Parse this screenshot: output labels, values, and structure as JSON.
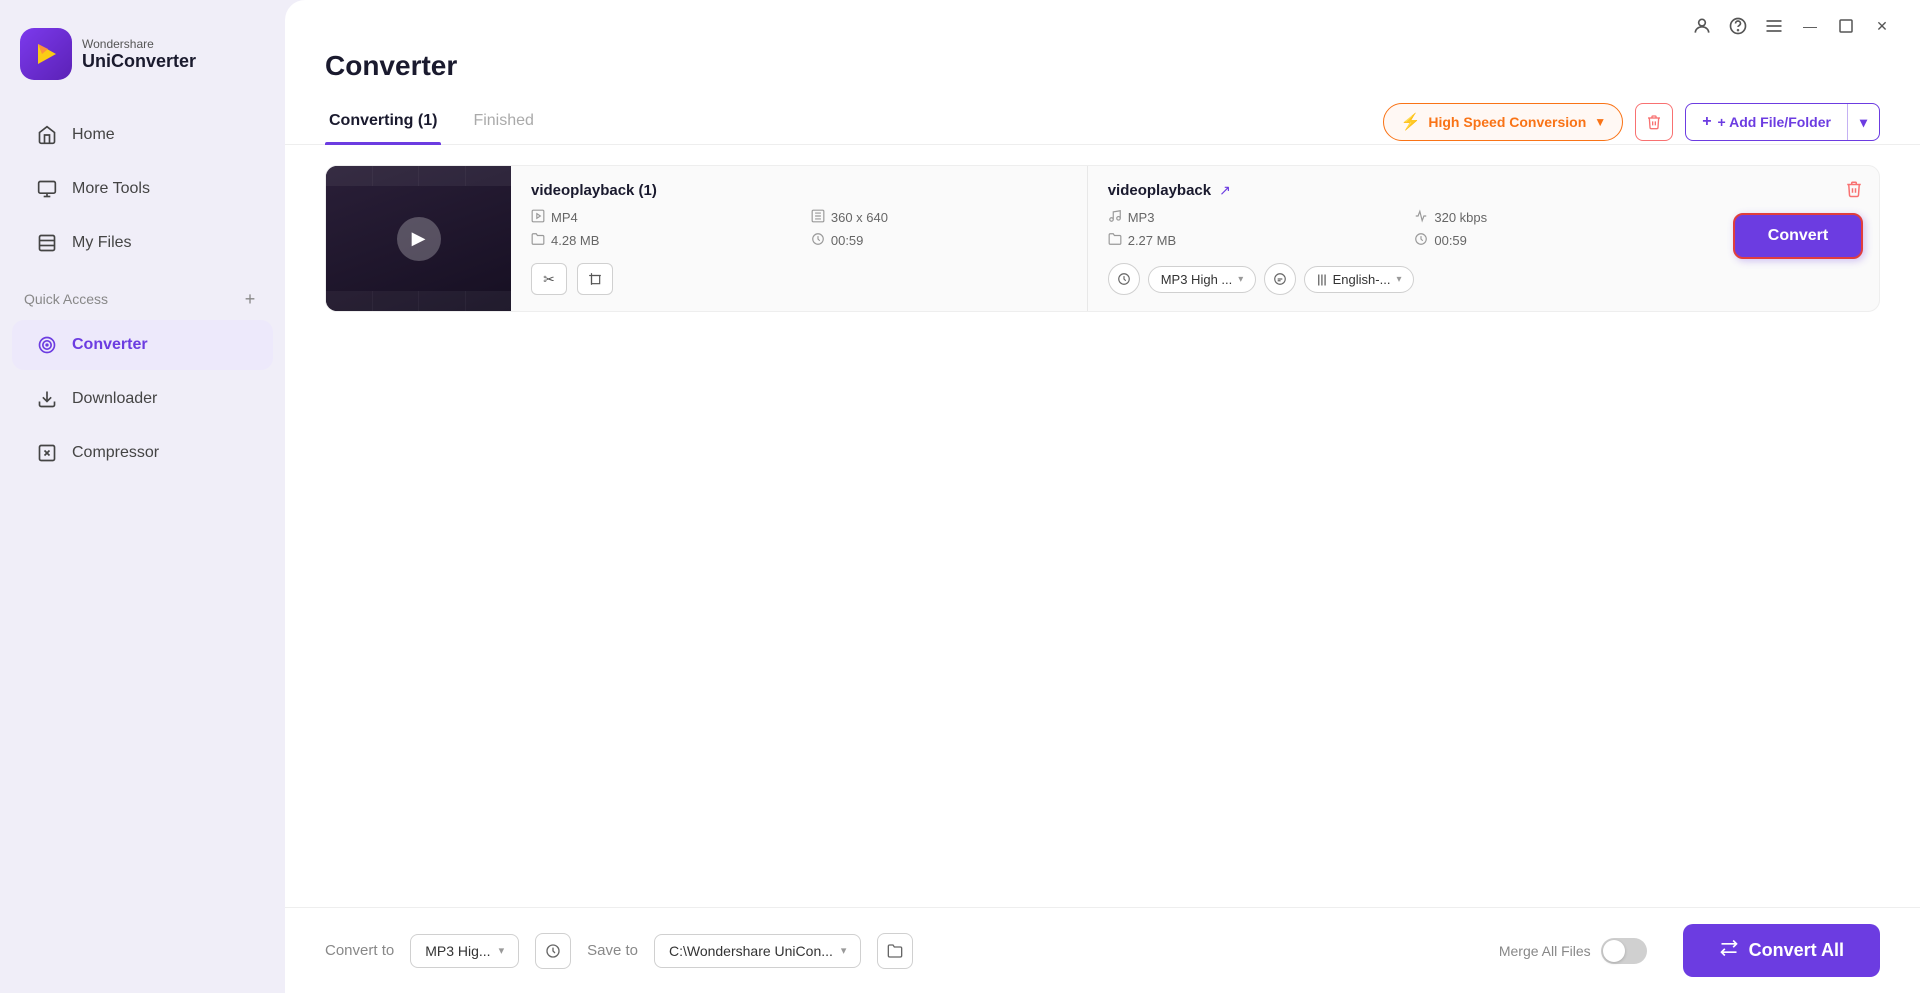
{
  "app": {
    "brand": "Wondershare",
    "product": "UniConverter"
  },
  "titlebar": {
    "buttons": [
      "profile",
      "headset",
      "menu",
      "minimize",
      "maximize",
      "close"
    ]
  },
  "sidebar": {
    "nav_items": [
      {
        "id": "home",
        "label": "Home",
        "icon": "home-icon"
      },
      {
        "id": "more-tools",
        "label": "More Tools",
        "icon": "tools-icon"
      },
      {
        "id": "my-files",
        "label": "My Files",
        "icon": "files-icon"
      }
    ],
    "quick_access_label": "Quick Access",
    "quick_access_items": [
      {
        "id": "converter",
        "label": "Converter",
        "icon": "converter-icon",
        "active": true
      },
      {
        "id": "downloader",
        "label": "Downloader",
        "icon": "downloader-icon"
      },
      {
        "id": "compressor",
        "label": "Compressor",
        "icon": "compressor-icon"
      }
    ]
  },
  "page": {
    "title": "Converter"
  },
  "tabs": {
    "converting_label": "Converting (1)",
    "finished_label": "Finished"
  },
  "toolbar": {
    "high_speed_label": "High Speed Conversion",
    "add_file_label": "+ Add File/Folder"
  },
  "file_card": {
    "source": {
      "name": "videoplayback (1)",
      "format": "MP4",
      "size": "4.28 MB",
      "resolution": "360 x 640",
      "duration": "00:59"
    },
    "output": {
      "name": "videoplayback",
      "format": "MP3",
      "size": "2.27 MB",
      "bitrate": "320 kbps",
      "duration": "00:59",
      "quality": "MP3 High ...",
      "language": "English-..."
    },
    "convert_btn_label": "Convert"
  },
  "bottom_bar": {
    "convert_to_label": "Convert to",
    "format_value": "MP3 Hig...",
    "save_to_label": "Save to",
    "path_value": "C:\\Wondershare UniCon...",
    "merge_label": "Merge All Files",
    "convert_all_label": "Convert All"
  }
}
